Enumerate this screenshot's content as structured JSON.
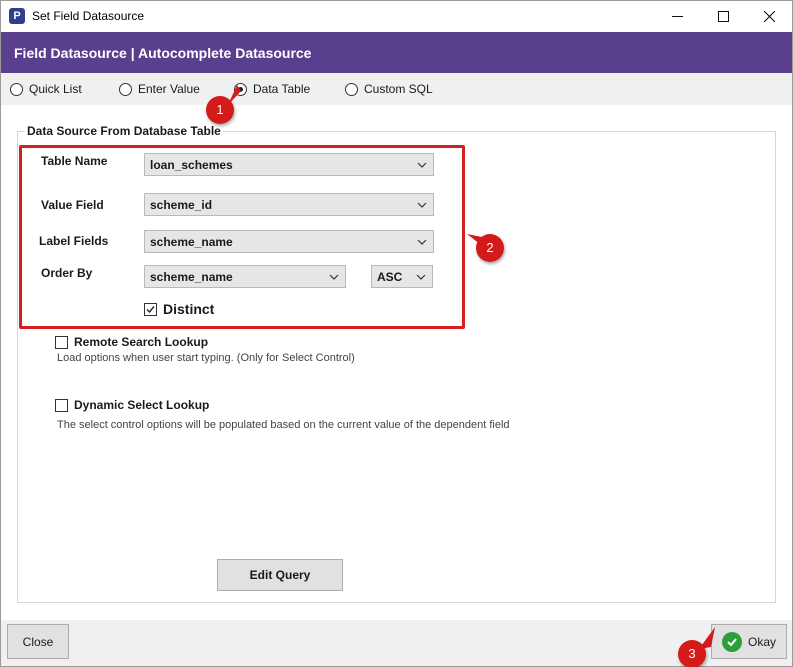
{
  "window": {
    "title": "Set Field Datasource",
    "app_icon_letter": "P"
  },
  "header": {
    "title": "Field Datasource | Autocomplete Datasource"
  },
  "source_options": [
    {
      "label": "Quick List",
      "selected": false
    },
    {
      "label": "Enter Value",
      "selected": false
    },
    {
      "label": "Data Table",
      "selected": true
    },
    {
      "label": "Custom SQL",
      "selected": false
    }
  ],
  "group": {
    "title": "Data Source From Database Table"
  },
  "form": {
    "table_name": {
      "label": "Table Name",
      "value": "loan_schemes"
    },
    "value_field": {
      "label": "Value Field",
      "value": "scheme_id"
    },
    "label_fields": {
      "label": "Label Fields",
      "value": "scheme_name"
    },
    "order_by": {
      "label": "Order By",
      "value": "scheme_name",
      "direction": "ASC"
    },
    "distinct": {
      "label": "Distinct",
      "checked": true
    }
  },
  "remote_search": {
    "label": "Remote Search Lookup",
    "checked": false,
    "help": "Load options when user start typing. (Only for Select Control)"
  },
  "dynamic_select": {
    "label": "Dynamic Select Lookup",
    "checked": false,
    "help": "The select control options will be populated based on the current value of the dependent field"
  },
  "buttons": {
    "edit_query": "Edit Query",
    "close": "Close",
    "okay": "Okay"
  },
  "callouts": [
    "1",
    "2",
    "3"
  ],
  "colors": {
    "header_bg": "#5b3f8f",
    "annotation_red": "#d81f1f",
    "okay_green": "#2e9e3c"
  }
}
